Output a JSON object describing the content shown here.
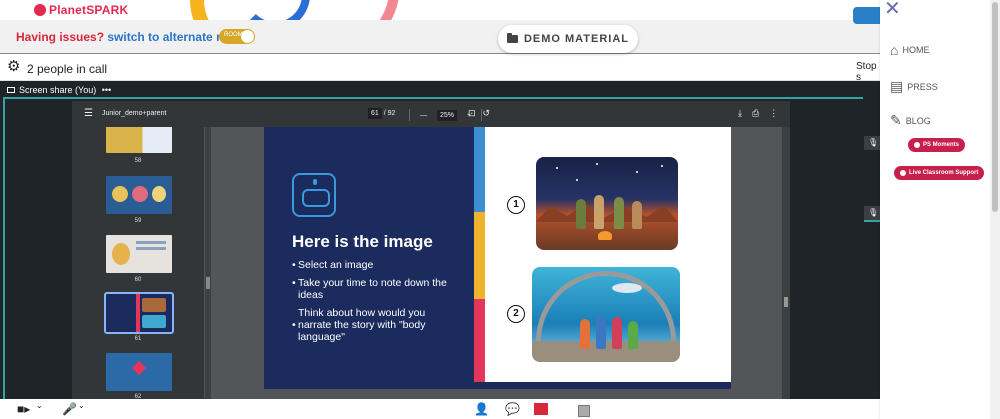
{
  "brand": {
    "logo_text": "PlanetSPARK"
  },
  "issue_bar": {
    "question": "Having issues?",
    "action": "switch to alternate room",
    "toggle_label": "ROOM"
  },
  "demo_material": {
    "label": "DEMO MATERIAL"
  },
  "call": {
    "people_count": "2 people in call",
    "stop_text": "Stop s"
  },
  "screen_share": {
    "tab_label": "Screen share (You)",
    "more": "•••"
  },
  "pdf": {
    "menu": "☰",
    "filename": "Junior_demo+parent",
    "page_current": "61",
    "page_total": "/ 92",
    "zoom_minus": "—",
    "zoom_value": "25%",
    "zoom_plus": "+",
    "fit_icon": "⊡",
    "rotate_icon": "↺",
    "download_icon": "⤓",
    "print_icon": "⎙",
    "more_icon": "⋮",
    "thumbnails": [
      {
        "num": "58"
      },
      {
        "num": "59"
      },
      {
        "num": "60"
      },
      {
        "num": "61"
      },
      {
        "num": "62"
      }
    ]
  },
  "slide": {
    "title": "Here is the image",
    "items": [
      "Select an image",
      "Take your time to note down the ideas",
      "Think about how would you",
      "narrate the story with \"body language\""
    ],
    "badge_1": "1",
    "badge_2": "2"
  },
  "side_nav": {
    "home": "HOME",
    "press": "PRESS",
    "blog": "BLOG",
    "ps_moments": "PS Moments",
    "live_support": "Live Classroom Support"
  },
  "colors": {
    "brand_red": "#d8283b",
    "link_blue": "#2a75c8",
    "pill_crimson": "#c7204d",
    "share_teal": "#36a3a1",
    "slide_navy": "#1b2b5e"
  }
}
